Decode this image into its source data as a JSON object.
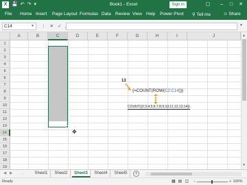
{
  "window": {
    "title": "Book1 - Excel",
    "sign_in": "Sign in"
  },
  "menu": {
    "tabs": [
      "File",
      "Home",
      "Insert",
      "Page Layout",
      "Formulas",
      "Data",
      "Review",
      "View",
      "Help",
      "Power Pivot"
    ],
    "tell_me": "Tell me",
    "share": "Share"
  },
  "formula_bar": {
    "name_box": "C14",
    "value": ""
  },
  "grid": {
    "columns": [
      "A",
      "B",
      "C",
      "D",
      "E",
      "F",
      "G",
      "H",
      "I",
      "J"
    ],
    "rows": [
      "1",
      "2",
      "3",
      "4",
      "5",
      "6",
      "7",
      "8",
      "9",
      "10",
      "11",
      "12",
      "13",
      "14",
      "15",
      "16",
      "17",
      "18",
      "19"
    ],
    "selected_column": "C",
    "selected_row": "14"
  },
  "annotation": {
    "count_label": "13",
    "formula_open": "{=COUNT(ROW(",
    "formula_ref": "C2:C14",
    "formula_close": "))}",
    "expansion": "COUNT({2;3;4;5;6;7;8;9;10;11;12;13;14})"
  },
  "sheets": [
    "Sheet1",
    "Sheet2",
    "Sheet3",
    "Sheet4",
    "Sheet5"
  ],
  "active_sheet": "Sheet3",
  "status": {
    "ready": "Ready",
    "zoom_minus": "−",
    "zoom_plus": "+",
    "zoom": "100%"
  },
  "colors": {
    "accent": "#217346",
    "reference": "#2e6fbf",
    "arrow": "#f0a020"
  }
}
